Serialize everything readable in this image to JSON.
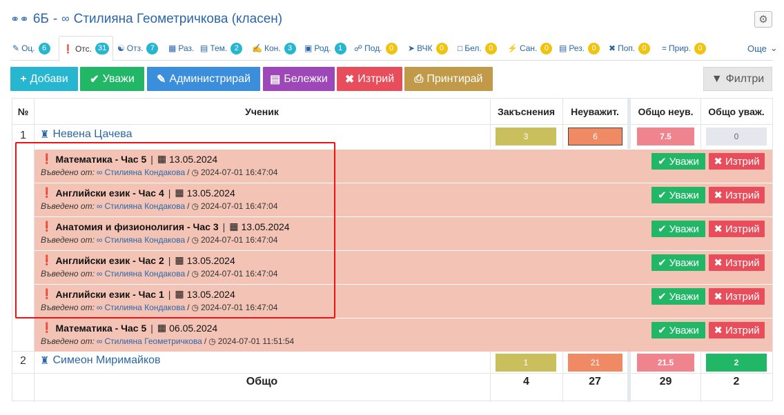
{
  "title": {
    "class": "6Б",
    "separator": "-",
    "teacher": "Стилияна Геометричкова (класен)"
  },
  "tabs": [
    {
      "label": "Оц.",
      "count": "6",
      "badge": "teal"
    },
    {
      "label": "Отс.",
      "count": "31",
      "badge": "teal"
    },
    {
      "label": "Отз.",
      "count": "7",
      "badge": "teal"
    },
    {
      "label": "Раз.",
      "count": "",
      "badge": ""
    },
    {
      "label": "Тем.",
      "count": "2",
      "badge": "teal"
    },
    {
      "label": "Кон.",
      "count": "3",
      "badge": "teal"
    },
    {
      "label": "Род.",
      "count": "1",
      "badge": "teal"
    },
    {
      "label": "Под.",
      "count": "0",
      "badge": "yellow"
    },
    {
      "label": "ВЧК",
      "count": "0",
      "badge": "yellow"
    },
    {
      "label": "Бел.",
      "count": "0",
      "badge": "yellow"
    },
    {
      "label": "Сан.",
      "count": "0",
      "badge": "yellow"
    },
    {
      "label": "Рез.",
      "count": "0",
      "badge": "yellow"
    },
    {
      "label": "Поп.",
      "count": "0",
      "badge": "yellow"
    },
    {
      "label": "Прир.",
      "count": "0",
      "badge": "yellow"
    }
  ],
  "more_label": "Още",
  "toolbar": {
    "add": "Добави",
    "excuse": "Уважи",
    "admin": "Администрирай",
    "notes": "Бележки",
    "delete": "Изтрий",
    "print": "Принтирай",
    "filters": "Филтри"
  },
  "columns": {
    "num": "№",
    "student": "Ученик",
    "late": "Закъснения",
    "unexcused": "Неуважит.",
    "total_unexcused": "Общо неув.",
    "total_excused": "Общо уваж."
  },
  "students": [
    {
      "num": "1",
      "name": "Невена Цачева",
      "late": "3",
      "unexcused": "6",
      "total_unexcused": "7.5",
      "total_excused": "0"
    },
    {
      "num": "2",
      "name": "Симеон Миримайков",
      "late": "1",
      "unexcused": "21",
      "total_unexcused": "21.5",
      "total_excused": "2"
    }
  ],
  "absences": [
    {
      "subject": "Математика - Час 5",
      "date": "13.05.2024",
      "entered_by_label": "Въведено от:",
      "by": "Стилияна Кондакова",
      "timestamp": "2024-07-01 16:47:04"
    },
    {
      "subject": "Английски език - Час 4",
      "date": "13.05.2024",
      "entered_by_label": "Въведено от:",
      "by": "Стилияна Кондакова",
      "timestamp": "2024-07-01 16:47:04"
    },
    {
      "subject": "Анатомия и физионолигия - Час 3",
      "date": "13.05.2024",
      "entered_by_label": "Въведено от:",
      "by": "Стилияна Кондакова",
      "timestamp": "2024-07-01 16:47:04"
    },
    {
      "subject": "Английски език - Час 2",
      "date": "13.05.2024",
      "entered_by_label": "Въведено от:",
      "by": "Стилияна Кондакова",
      "timestamp": "2024-07-01 16:47:04"
    },
    {
      "subject": "Английски език - Час 1",
      "date": "13.05.2024",
      "entered_by_label": "Въведено от:",
      "by": "Стилияна Кондакова",
      "timestamp": "2024-07-01 16:47:04"
    },
    {
      "subject": "Математика - Час 5",
      "date": "06.05.2024",
      "entered_by_label": "Въведено от:",
      "by": "Стилияна Геометричкова",
      "timestamp": "2024-07-01 11:51:54"
    }
  ],
  "row_actions": {
    "excuse": "Уважи",
    "delete": "Изтрий"
  },
  "totals": {
    "label": "Общо",
    "late": "4",
    "unexcused": "27",
    "total_unexcused": "29",
    "total_excused": "2"
  },
  "colors": {
    "link": "#2a66a8",
    "late_box": "#c9bf5d",
    "unexcused_box": "#f08a65",
    "total_unexcused_box": "#f0848e",
    "total_excused_zero_box": "#e4e8ee",
    "total_excused_box": "#21b766",
    "absence_bg": "#f3c4b5",
    "highlight": "#ee1111"
  }
}
